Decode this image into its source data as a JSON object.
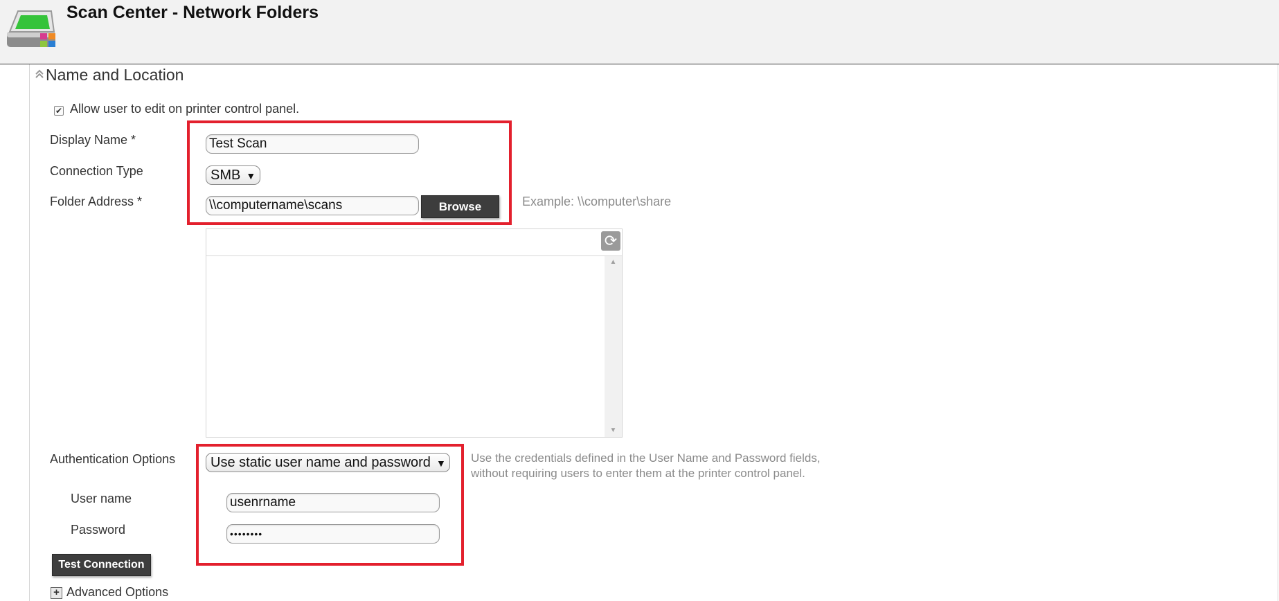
{
  "header": {
    "title": "Scan Center - Network Folders",
    "app_icon": "scanner-app-icon"
  },
  "section": {
    "title": "Name and Location",
    "collapse_icon": "collapse-chevron-icon"
  },
  "allow_edit": {
    "label": "Allow user to edit on printer control panel.",
    "checked": true
  },
  "form": {
    "display_name_label": "Display Name *",
    "display_name_value": "Test Scan",
    "connection_type_label": "Connection Type",
    "connection_type_value": "SMB",
    "folder_address_label": "Folder Address *",
    "folder_address_value": "\\\\computername\\scans",
    "browse_label": "Browse",
    "folder_example": "Example: \\\\computer\\share",
    "auth_label": "Authentication Options",
    "auth_value": "Use static user name and password",
    "auth_hint_line1": "Use the credentials defined in the User Name and Password fields,",
    "auth_hint_line2": "without requiring users to enter them at the printer control panel.",
    "username_label": "User name",
    "username_value": "usenrname",
    "password_label": "Password",
    "password_value": "••••••••",
    "test_connection_label": "Test Connection"
  },
  "browse_panel": {
    "refresh_icon": "refresh-icon"
  },
  "advanced": {
    "label": "Advanced Options",
    "expand_icon": "expand-plus-icon"
  },
  "colors": {
    "highlight": "#e3202d",
    "button_dark": "#3d3d3d",
    "header_bg": "#f2f2f2"
  }
}
